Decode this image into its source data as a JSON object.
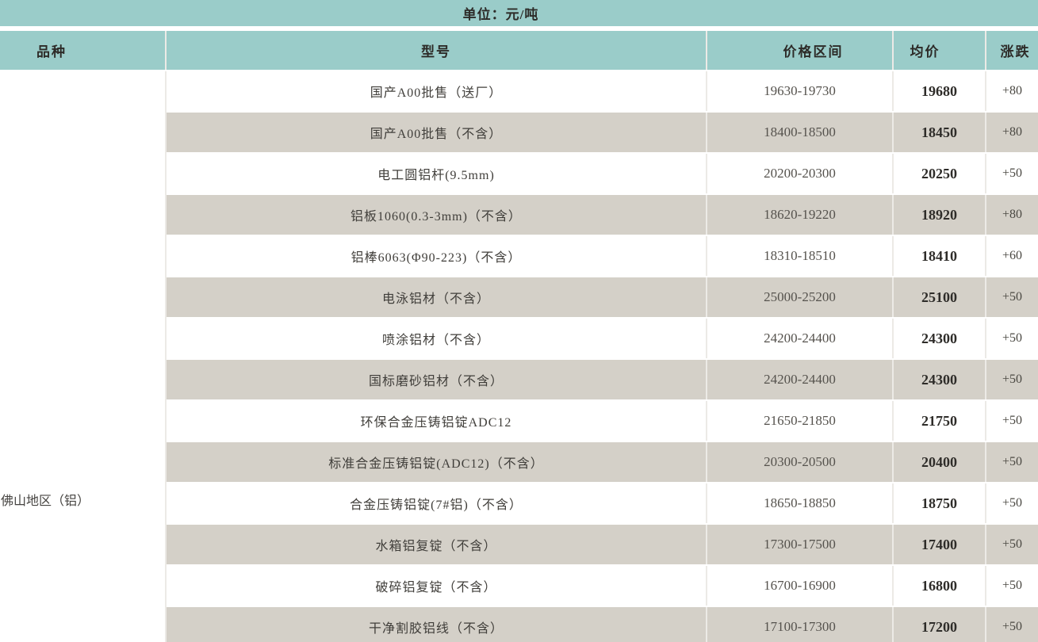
{
  "colors": {
    "header_teal": "#9accc9",
    "row_alt_gray": "#d4d0c8",
    "row_white": "#ffffff",
    "separator": "#ffffff",
    "grid_line": "#eceae6"
  },
  "chart_data": {
    "type": "table",
    "title": "单位：元/吨",
    "columns": [
      "品种",
      "型号",
      "价格区间",
      "均价",
      "涨跌"
    ],
    "region": "佛山地区（铝）",
    "rows": [
      {
        "model": "国产A00批售（送厂）",
        "price_range": "19630-19730",
        "avg_price": "19680",
        "change": "+80"
      },
      {
        "model": "国产A00批售（不含）",
        "price_range": "18400-18500",
        "avg_price": "18450",
        "change": "+80"
      },
      {
        "model": "电工圆铝杆(9.5mm)",
        "price_range": "20200-20300",
        "avg_price": "20250",
        "change": "+50"
      },
      {
        "model": "铝板1060(0.3-3mm)（不含）",
        "price_range": "18620-19220",
        "avg_price": "18920",
        "change": "+80"
      },
      {
        "model": "铝棒6063(Φ90-223)（不含）",
        "price_range": "18310-18510",
        "avg_price": "18410",
        "change": "+60"
      },
      {
        "model": "电泳铝材（不含）",
        "price_range": "25000-25200",
        "avg_price": "25100",
        "change": "+50"
      },
      {
        "model": "喷涂铝材（不含）",
        "price_range": "24200-24400",
        "avg_price": "24300",
        "change": "+50"
      },
      {
        "model": "国标磨砂铝材（不含）",
        "price_range": "24200-24400",
        "avg_price": "24300",
        "change": "+50"
      },
      {
        "model": "环保合金压铸铝锭ADC12",
        "price_range": "21650-21850",
        "avg_price": "21750",
        "change": "+50"
      },
      {
        "model": "标准合金压铸铝锭(ADC12)（不含）",
        "price_range": "20300-20500",
        "avg_price": "20400",
        "change": "+50"
      },
      {
        "model": "合金压铸铝锭(7#铝)（不含）",
        "price_range": "18650-18850",
        "avg_price": "18750",
        "change": "+50"
      },
      {
        "model": "水箱铝复锭（不含）",
        "price_range": "17300-17500",
        "avg_price": "17400",
        "change": "+50"
      },
      {
        "model": "破碎铝复锭（不含）",
        "price_range": "16700-16900",
        "avg_price": "16800",
        "change": "+50"
      },
      {
        "model": "干净割胶铝线（不含）",
        "price_range": "17100-17300",
        "avg_price": "17200",
        "change": "+50"
      }
    ]
  }
}
